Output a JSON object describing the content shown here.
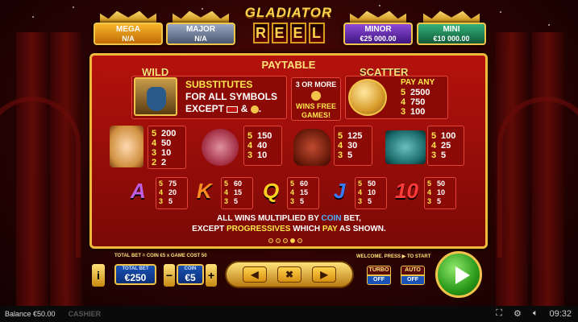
{
  "jackpots": [
    {
      "name": "MEGA",
      "value": "N/A",
      "color": "#e79a1a"
    },
    {
      "name": "MAJOR",
      "value": "N/A",
      "color": "#6f7e9a"
    },
    {
      "name": "MINOR",
      "value": "€25 000.00",
      "color": "#6a2bb0"
    },
    {
      "name": "MINI",
      "value": "€10 000.00",
      "color": "#1f8a5a"
    }
  ],
  "logo": {
    "line1": "GLADIATOR",
    "reel": [
      "R",
      "E",
      "E",
      "L"
    ]
  },
  "paytable": {
    "title": "PAYTABLE",
    "wild_header": "WILD",
    "scatter_header": "SCATTER",
    "substitutes": [
      "SUBSTITUTES",
      "FOR ALL SYMBOLS",
      "EXCEPT",
      "&"
    ],
    "free_games": {
      "line1": "3 OR MORE",
      "line2": "WINS FREE",
      "line3": "GAMES!"
    },
    "scatter_pays": {
      "label": "PAY ANY",
      "rows": [
        [
          "5",
          "2500"
        ],
        [
          "4",
          "750"
        ],
        [
          "3",
          "100"
        ]
      ]
    },
    "premium": [
      {
        "icon": "empress-icon",
        "rows": [
          [
            "5",
            "200"
          ],
          [
            "4",
            "50"
          ],
          [
            "3",
            "10"
          ],
          [
            "2",
            "2"
          ]
        ]
      },
      {
        "icon": "sword-shield-icon",
        "rows": [
          [
            "5",
            "150"
          ],
          [
            "4",
            "40"
          ],
          [
            "3",
            "10"
          ]
        ]
      },
      {
        "icon": "helmet-icon",
        "rows": [
          [
            "5",
            "125"
          ],
          [
            "4",
            "30"
          ],
          [
            "3",
            "5"
          ]
        ]
      },
      {
        "icon": "chariot-icon",
        "rows": [
          [
            "5",
            "100"
          ],
          [
            "4",
            "25"
          ],
          [
            "3",
            "5"
          ]
        ]
      }
    ],
    "royals": [
      {
        "letter": "A",
        "color": "#c060e0",
        "rows": [
          [
            "5",
            "75"
          ],
          [
            "4",
            "20"
          ],
          [
            "3",
            "5"
          ]
        ]
      },
      {
        "letter": "K",
        "color": "#ff8a20",
        "rows": [
          [
            "5",
            "60"
          ],
          [
            "4",
            "15"
          ],
          [
            "3",
            "5"
          ]
        ]
      },
      {
        "letter": "Q",
        "color": "#ffd020",
        "rows": [
          [
            "5",
            "60"
          ],
          [
            "4",
            "15"
          ],
          [
            "3",
            "5"
          ]
        ]
      },
      {
        "letter": "J",
        "color": "#3a7aff",
        "rows": [
          [
            "5",
            "50"
          ],
          [
            "4",
            "10"
          ],
          [
            "3",
            "5"
          ]
        ]
      },
      {
        "letter": "10",
        "color": "#ff3a3a",
        "rows": [
          [
            "5",
            "50"
          ],
          [
            "4",
            "10"
          ],
          [
            "3",
            "5"
          ]
        ]
      }
    ],
    "footer1": {
      "a": "ALL WINS MULTIPLIED BY ",
      "b": "COIN",
      "c": " BET,"
    },
    "footer2": {
      "a": "EXCEPT ",
      "b": "PROGRESSIVES",
      "c": " WHICH ",
      "d": "PAY",
      "e": " AS SHOWN."
    },
    "page_dots": 5,
    "active_dot": 3
  },
  "controls": {
    "bet_formula": "TOTAL BET = COIN €5 x GAME COST 50",
    "welcome": "WELCOME. PRESS ▶ TO START",
    "info": "i",
    "total_bet_label": "TOTAL BET",
    "total_bet_value": "€250",
    "coin_label": "COIN",
    "coin_value": "€5",
    "minus": "−",
    "plus": "+",
    "prev": "◀",
    "close": "✖",
    "next": "▶",
    "turbo_label": "TURBO",
    "turbo_value": "OFF",
    "auto_label": "AUTO",
    "auto_value": "OFF"
  },
  "bottom_bar": {
    "balance": "Balance €50.00",
    "cashier": "CASHIER",
    "time": "09:32"
  }
}
